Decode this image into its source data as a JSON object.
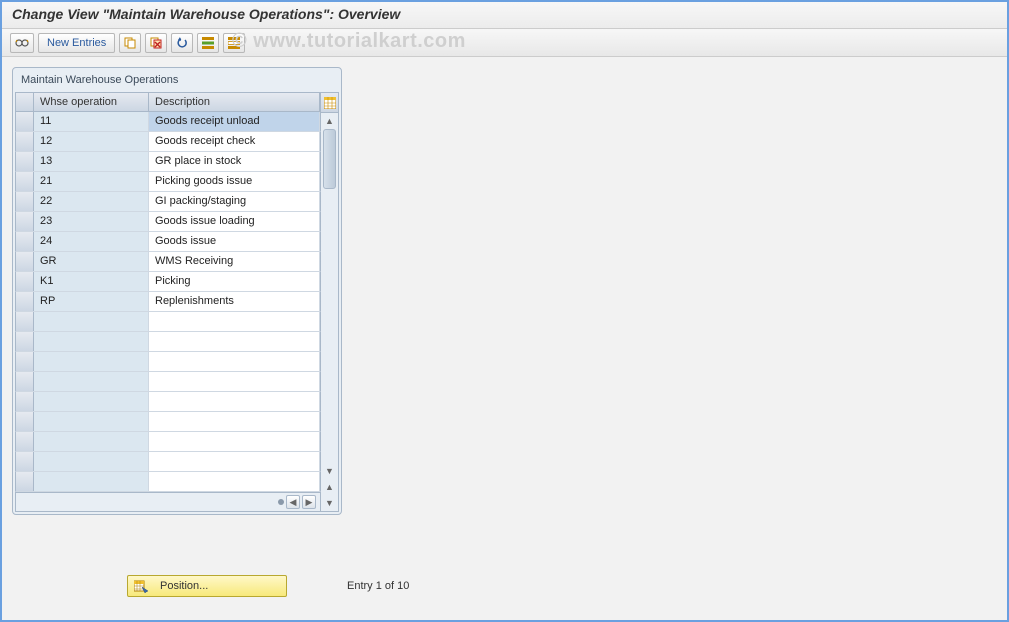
{
  "title": "Change View \"Maintain Warehouse Operations\": Overview",
  "watermark": "© www.tutorialkart.com",
  "toolbar": {
    "new_entries": "New Entries"
  },
  "panel": {
    "title": "Maintain Warehouse Operations",
    "columns": {
      "op": "Whse operation",
      "desc": "Description"
    },
    "rows": [
      {
        "op": "11",
        "desc": "Goods receipt unload",
        "selected": true
      },
      {
        "op": "12",
        "desc": "Goods receipt check"
      },
      {
        "op": "13",
        "desc": "GR place in stock"
      },
      {
        "op": "21",
        "desc": "Picking goods issue"
      },
      {
        "op": "22",
        "desc": "GI packing/staging"
      },
      {
        "op": "23",
        "desc": "Goods issue loading"
      },
      {
        "op": "24",
        "desc": "Goods issue"
      },
      {
        "op": "GR",
        "desc": "WMS Receiving"
      },
      {
        "op": "K1",
        "desc": "Picking"
      },
      {
        "op": "RP",
        "desc": "Replenishments"
      }
    ],
    "empty_rows": 9
  },
  "footer": {
    "position_label": "Position...",
    "entry_label": "Entry 1 of 10"
  }
}
